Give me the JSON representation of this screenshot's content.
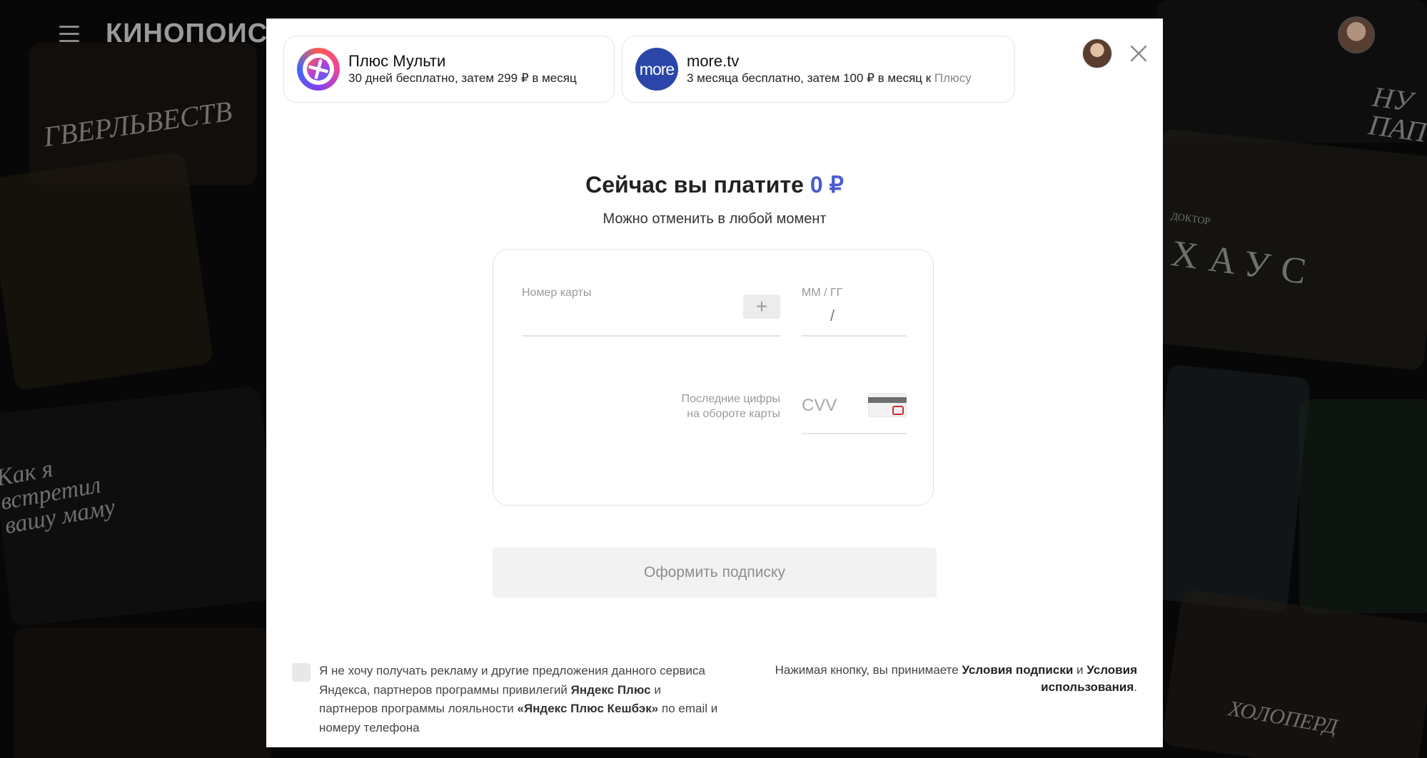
{
  "background": {
    "logo": "КИНОПОИСК",
    "poster_texts": [
      "ГВЕРЛЬВЕСТВ",
      "Как я встретил вашу маму",
      "ХАУС",
      "НУ ПАП",
      "ДОКТОР",
      "ХОЛОПЕРД"
    ]
  },
  "plans": [
    {
      "title": "Плюс Мульти",
      "subtitle": "30 дней бесплатно, затем 299 ₽ в месяц",
      "subtitle_tail": "",
      "icon": "plus-icon"
    },
    {
      "title": "more.tv",
      "subtitle": "3 месяца бесплатно, затем 100 ₽ в месяц к",
      "subtitle_tail": "Плюсу",
      "icon_text": "more",
      "icon": "more-tv-icon"
    }
  ],
  "payment": {
    "title": "Сейчас вы платите",
    "amount": "0 ₽",
    "subtitle": "Можно отменить в любой момент"
  },
  "card_form": {
    "card_number_label": "Номер карты",
    "card_number_value": "",
    "scan_button": "+",
    "expiry_label": "ММ  /  ГГ",
    "expiry_separator": "/",
    "cvv_hint_line1": "Последние цифры",
    "cvv_hint_line2": "на обороте карты",
    "cvv_placeholder": "CVV"
  },
  "submit_label": "Оформить подписку",
  "consent": {
    "part1": "Я не хочу получать рекламу и другие предложения данного сервиса Яндекса, партнеров программы привилегий ",
    "brand1": "Яндекс Плюс",
    "part2": " и партнеров программы лояльности ",
    "brand2": "«Яндекс Плюс Кешбэк»",
    "part3": " по email и номеру телефона"
  },
  "terms": {
    "prefix": "Нажимая кнопку, вы принимаете ",
    "link1": "Условия подписки",
    "middle": " и ",
    "link2": "Условия использования",
    "suffix": "."
  },
  "colors": {
    "accent": "#4a5bd0",
    "more_tv": "#2a46a8"
  }
}
